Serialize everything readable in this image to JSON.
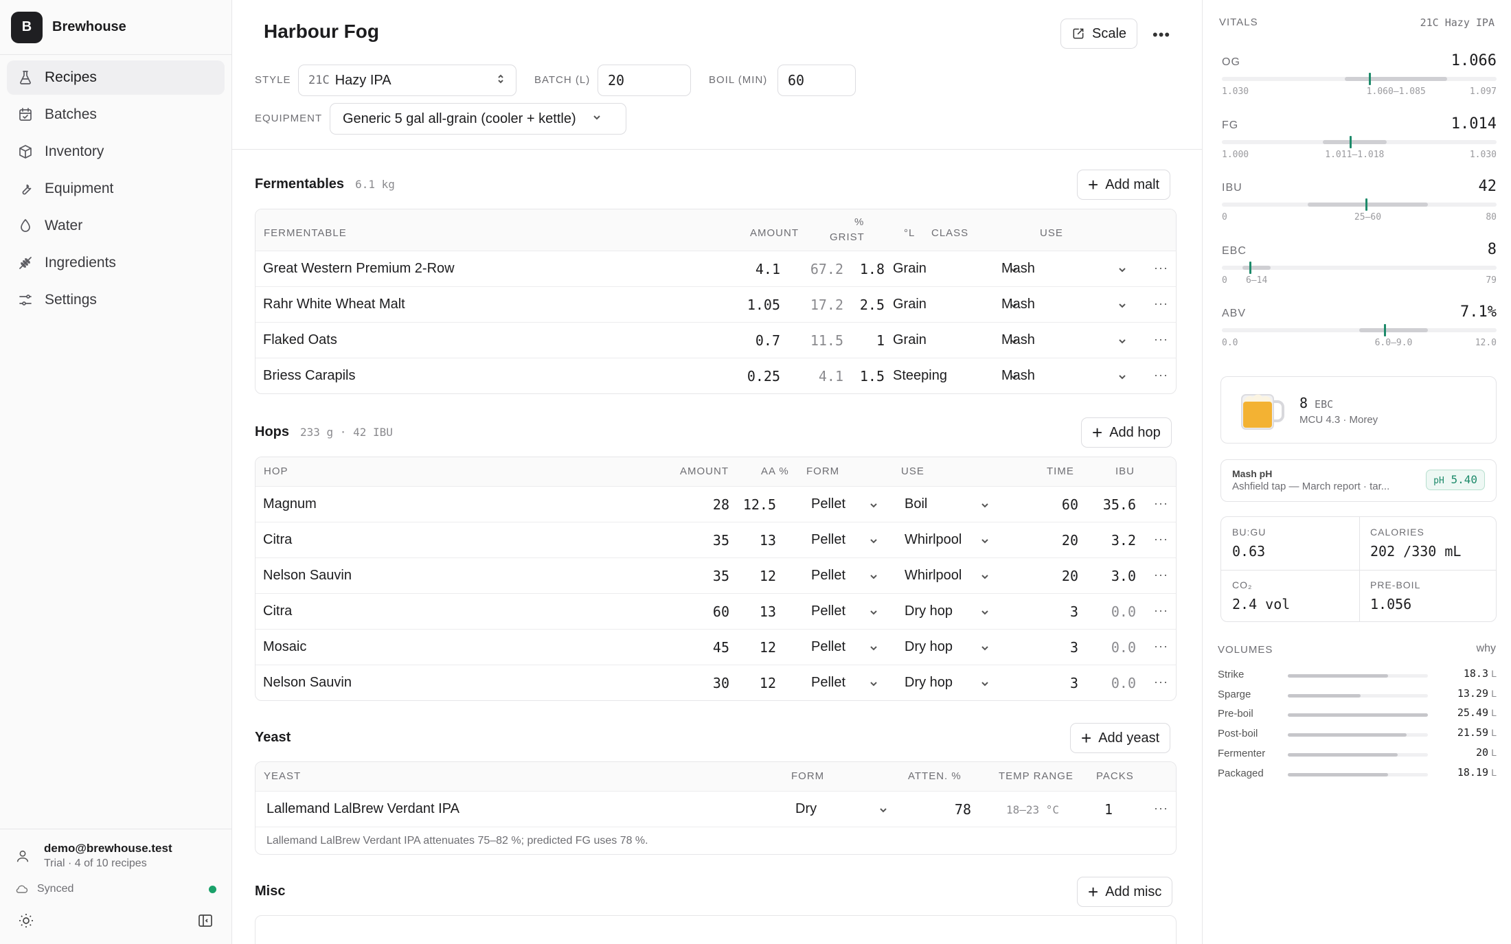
{
  "app": {
    "logo_letter": "B",
    "name": "Brewhouse"
  },
  "nav": [
    {
      "label": "Recipes",
      "icon": "flask-icon",
      "active": true
    },
    {
      "label": "Batches",
      "icon": "calendar-icon"
    },
    {
      "label": "Inventory",
      "icon": "box-icon"
    },
    {
      "label": "Equipment",
      "icon": "wrench-icon"
    },
    {
      "label": "Water",
      "icon": "droplet-icon"
    },
    {
      "label": "Ingredients",
      "icon": "wheat-icon"
    },
    {
      "label": "Settings",
      "icon": "sliders-icon"
    }
  ],
  "user": {
    "email": "demo@brewhouse.test",
    "plan": "Trial · 4 of 10 recipes",
    "sync_status": "Synced",
    "sync_color": "#1aa16a"
  },
  "recipe": {
    "name": "Harbour Fog",
    "scale_label": "Scale",
    "style_label": "STYLE",
    "style_code": "21C",
    "style_name": "Hazy IPA",
    "batch_label": "BATCH (L)",
    "batch_value": "20",
    "boil_label": "BOIL (MIN)",
    "boil_value": "60",
    "equipment_label": "EQUIPMENT",
    "equipment_value": "Generic 5 gal all-grain (cooler + kettle)"
  },
  "fermentables": {
    "title": "Fermentables",
    "summary": "6.1 kg",
    "add_label": "Add malt",
    "headers": {
      "name": "FERMENTABLE",
      "amount": "AMOUNT",
      "grist1": "%",
      "grist2": "GRIST",
      "lovibond": "°L",
      "class": "CLASS",
      "use": "USE"
    },
    "rows": [
      {
        "name": "Great Western Premium 2-Row",
        "amount": "4.1",
        "grist": "67.2",
        "lovibond": "1.8",
        "class": "Grain",
        "use": "Mash"
      },
      {
        "name": "Rahr White Wheat Malt",
        "amount": "1.05",
        "grist": "17.2",
        "lovibond": "2.5",
        "class": "Grain",
        "use": "Mash"
      },
      {
        "name": "Flaked Oats",
        "amount": "0.7",
        "grist": "11.5",
        "lovibond": "1",
        "class": "Grain",
        "use": "Mash"
      },
      {
        "name": "Briess Carapils",
        "amount": "0.25",
        "grist": "4.1",
        "lovibond": "1.5",
        "class": "Steeping",
        "use": "Mash"
      }
    ]
  },
  "hops": {
    "title": "Hops",
    "summary": "233 g · 42 IBU",
    "add_label": "Add hop",
    "headers": {
      "name": "HOP",
      "amount": "AMOUNT",
      "aa": "AA %",
      "form": "FORM",
      "use": "USE",
      "time": "TIME",
      "ibu": "IBU"
    },
    "rows": [
      {
        "name": "Magnum",
        "amount": "28",
        "aa": "12.5",
        "form": "Pellet",
        "use": "Boil",
        "time": "60",
        "ibu": "35.6"
      },
      {
        "name": "Citra",
        "amount": "35",
        "aa": "13",
        "form": "Pellet",
        "use": "Whirlpool",
        "time": "20",
        "ibu": "3.2"
      },
      {
        "name": "Nelson Sauvin",
        "amount": "35",
        "aa": "12",
        "form": "Pellet",
        "use": "Whirlpool",
        "time": "20",
        "ibu": "3.0"
      },
      {
        "name": "Citra",
        "amount": "60",
        "aa": "13",
        "form": "Pellet",
        "use": "Dry hop",
        "time": "3",
        "ibu": "0.0"
      },
      {
        "name": "Mosaic",
        "amount": "45",
        "aa": "12",
        "form": "Pellet",
        "use": "Dry hop",
        "time": "3",
        "ibu": "0.0"
      },
      {
        "name": "Nelson Sauvin",
        "amount": "30",
        "aa": "12",
        "form": "Pellet",
        "use": "Dry hop",
        "time": "3",
        "ibu": "0.0"
      }
    ]
  },
  "yeast": {
    "title": "Yeast",
    "add_label": "Add yeast",
    "headers": {
      "name": "YEAST",
      "form": "FORM",
      "atten": "ATTEN. %",
      "temp": "TEMP RANGE",
      "packs": "PACKS"
    },
    "rows": [
      {
        "name": "Lallemand LalBrew Verdant IPA",
        "form": "Dry",
        "atten": "78",
        "temp": "18–23 °C",
        "packs": "1"
      }
    ],
    "note": "Lallemand LalBrew Verdant IPA attenuates 75–82 %; predicted FG uses 78 %."
  },
  "misc": {
    "title": "Misc",
    "add_label": "Add misc"
  },
  "vitals": {
    "title": "VITALS",
    "style_tag": "21C Hazy IPA",
    "metrics": [
      {
        "name": "OG",
        "value": "1.066",
        "min_label": "1.030",
        "range_label": "1.060–1.085",
        "max_label": "1.097",
        "min": 1.03,
        "max": 1.097,
        "range_lo": 1.06,
        "range_hi": 1.085,
        "actual": 1.066
      },
      {
        "name": "FG",
        "value": "1.014",
        "min_label": "1.000",
        "range_label": "1.011–1.018",
        "max_label": "1.030",
        "min": 1.0,
        "max": 1.03,
        "range_lo": 1.011,
        "range_hi": 1.018,
        "actual": 1.014
      },
      {
        "name": "IBU",
        "value": "42",
        "min_label": "0",
        "range_label": "25–60",
        "max_label": "80",
        "min": 0,
        "max": 80,
        "range_lo": 25,
        "range_hi": 60,
        "actual": 42
      },
      {
        "name": "EBC",
        "value": "8",
        "min_label": "0",
        "range_label": "6–14",
        "max_label": "79",
        "min": 0,
        "max": 79,
        "range_lo": 6,
        "range_hi": 14,
        "actual": 8
      },
      {
        "name": "ABV",
        "value": "7.1%",
        "min_label": "0.0",
        "range_label": "6.0–9.0",
        "max_label": "12.0",
        "min": 0,
        "max": 12,
        "range_lo": 6,
        "range_hi": 9,
        "actual": 7.1
      }
    ],
    "color_card": {
      "ebc": "8",
      "ebc_unit": "EBC",
      "detail": "MCU 4.3 · Morey",
      "beer_color": "#f3b233"
    },
    "ph_card": {
      "label": "Mash pH",
      "detail": "Ashfield tap — March report · tar...",
      "badge_prefix": "pH",
      "badge_value": "5.40",
      "badge_color": "#1d8a6a"
    },
    "stats": [
      {
        "label": "BU:GU",
        "value": "0.63"
      },
      {
        "label": "CALORIES",
        "value": "202 /330 mL"
      },
      {
        "label": "CO₂",
        "value": "2.4 vol"
      },
      {
        "label": "PRE-BOIL",
        "value": "1.056"
      }
    ],
    "volumes_title": "VOLUMES",
    "volumes_hint": "why",
    "volumes": [
      {
        "name": "Strike",
        "value": 18.3,
        "label": "18.3"
      },
      {
        "name": "Sparge",
        "value": 13.29,
        "label": "13.29"
      },
      {
        "name": "Pre-boil",
        "value": 25.49,
        "label": "25.49"
      },
      {
        "name": "Post-boil",
        "value": 21.59,
        "label": "21.59"
      },
      {
        "name": "Fermenter",
        "value": 20,
        "label": "20"
      },
      {
        "name": "Packaged",
        "value": 18.19,
        "label": "18.19"
      }
    ],
    "volume_unit": "L"
  }
}
